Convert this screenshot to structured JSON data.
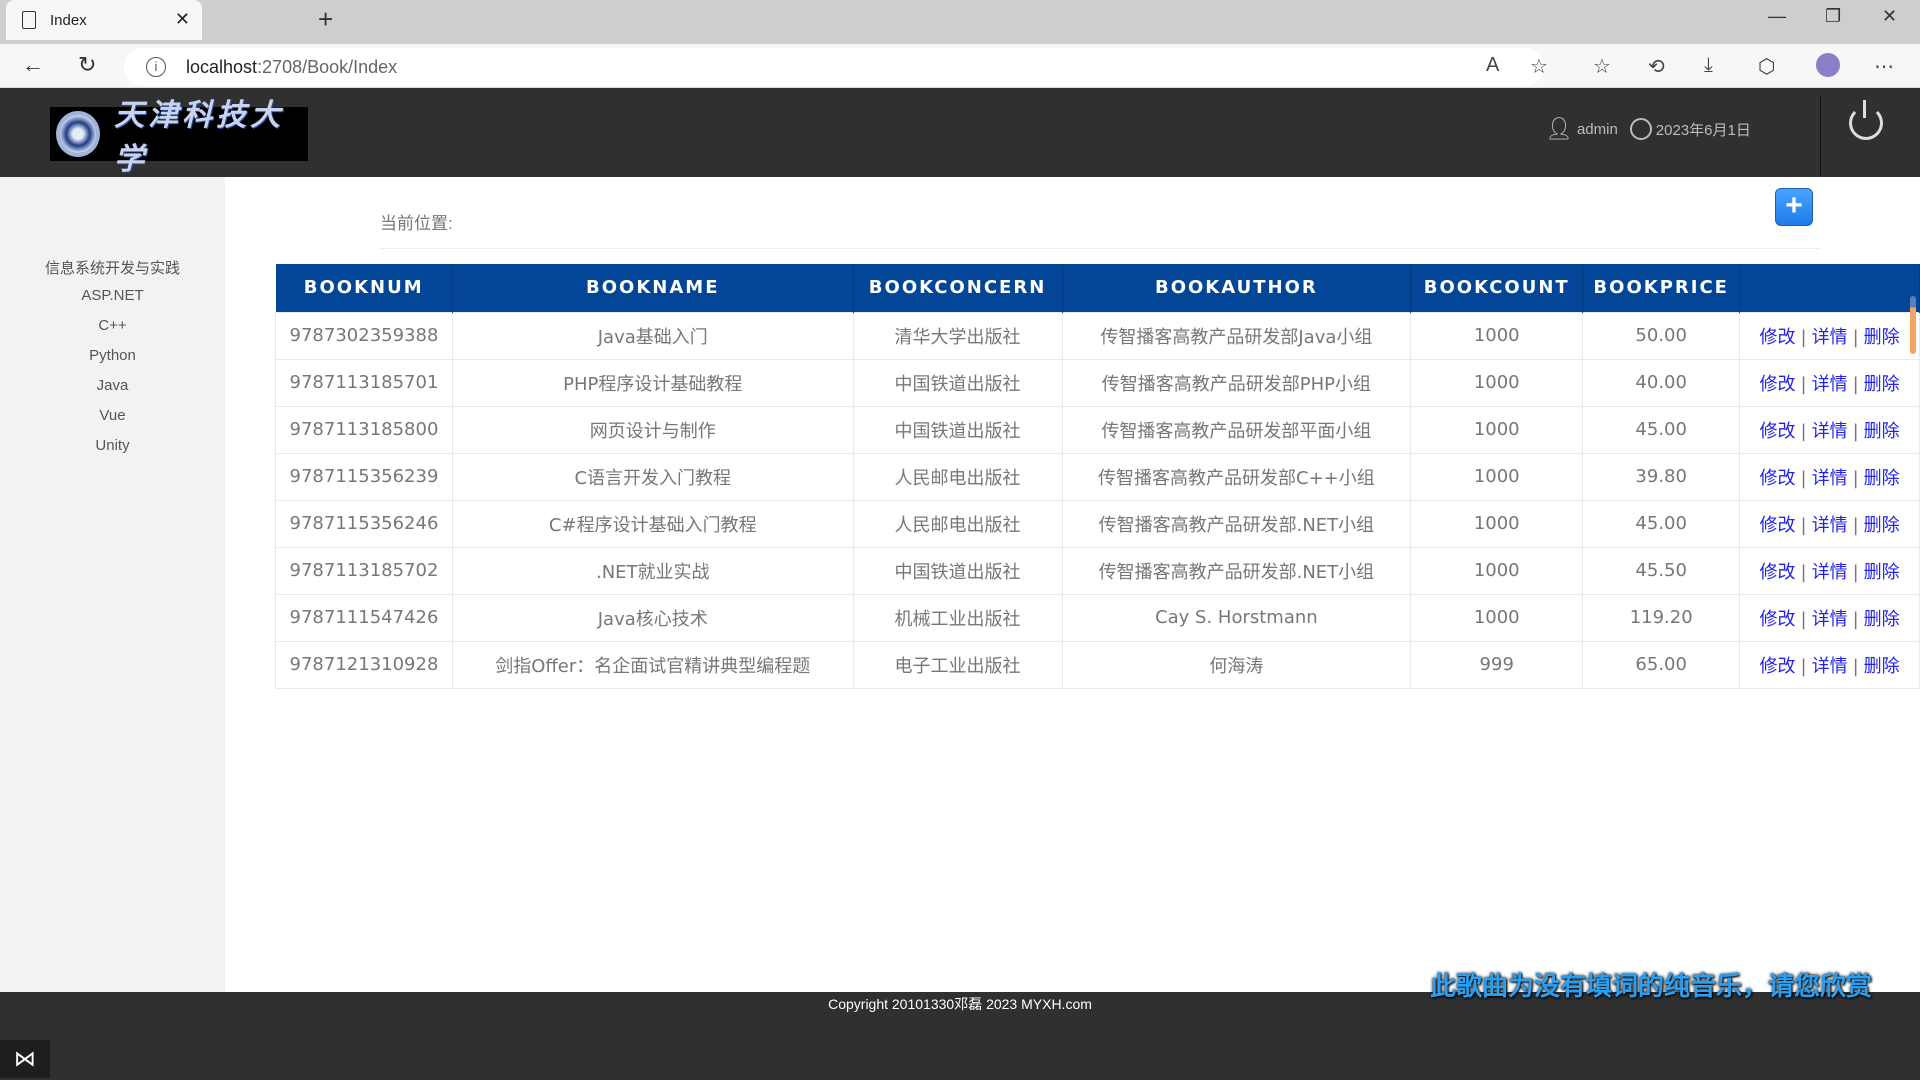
{
  "browser": {
    "tab_title": "Index",
    "url_host": "localhost",
    "url_path": ":2708/Book/Index"
  },
  "header": {
    "logo_text": "天津科技大学",
    "username": "admin",
    "date": "2023年6月1日"
  },
  "sidebar": {
    "items": [
      {
        "label": "信息系统开发与实践"
      },
      {
        "label": "ASP.NET"
      },
      {
        "label": "C++"
      },
      {
        "label": "Python"
      },
      {
        "label": "Java"
      },
      {
        "label": "Vue"
      },
      {
        "label": "Unity"
      }
    ]
  },
  "main": {
    "breadcrumb": "当前位置:",
    "add_label": "+",
    "columns": [
      "BOOKNUM",
      "BOOKNAME",
      "BOOKCONCERN",
      "BOOKAUTHOR",
      "BOOKCOUNT",
      "BOOKPRICE",
      ""
    ],
    "actions": {
      "edit": "修改",
      "detail": "详情",
      "delete": "删除",
      "sep": "|"
    },
    "rows": [
      [
        "9787302359388",
        "Java基础入门",
        "清华大学出版社",
        "传智播客高教产品研发部Java小组",
        "1000",
        "50.00"
      ],
      [
        "9787113185701",
        "PHP程序设计基础教程",
        "中国铁道出版社",
        "传智播客高教产品研发部PHP小组",
        "1000",
        "40.00"
      ],
      [
        "9787113185800",
        "网页设计与制作",
        "中国铁道出版社",
        "传智播客高教产品研发部平面小组",
        "1000",
        "45.00"
      ],
      [
        "9787115356239",
        "C语言开发入门教程",
        "人民邮电出版社",
        "传智播客高教产品研发部C++小组",
        "1000",
        "39.80"
      ],
      [
        "9787115356246",
        "C#程序设计基础入门教程",
        "人民邮电出版社",
        "传智播客高教产品研发部.NET小组",
        "1000",
        "45.00"
      ],
      [
        "9787113185702",
        ".NET就业实战",
        "中国铁道出版社",
        "传智播客高教产品研发部.NET小组",
        "1000",
        "45.50"
      ],
      [
        "9787111547426",
        "Java核心技术",
        "机械工业出版社",
        "Cay S. Horstmann",
        "1000",
        "119.20"
      ],
      [
        "9787121310928",
        "剑指Offer：名企面试官精讲典型编程题",
        "电子工业出版社",
        "何海涛",
        "999",
        "65.00"
      ]
    ]
  },
  "footer": {
    "copyright": "Copyright 20101330邓磊 2023 MYXH.com",
    "lyric": "此歌曲为没有填词的纯音乐，请您欣赏"
  },
  "colors": {
    "header_bg": "#303030",
    "table_header": "#034597",
    "link": "#2323ee",
    "lyric": "#2a9ef0"
  }
}
